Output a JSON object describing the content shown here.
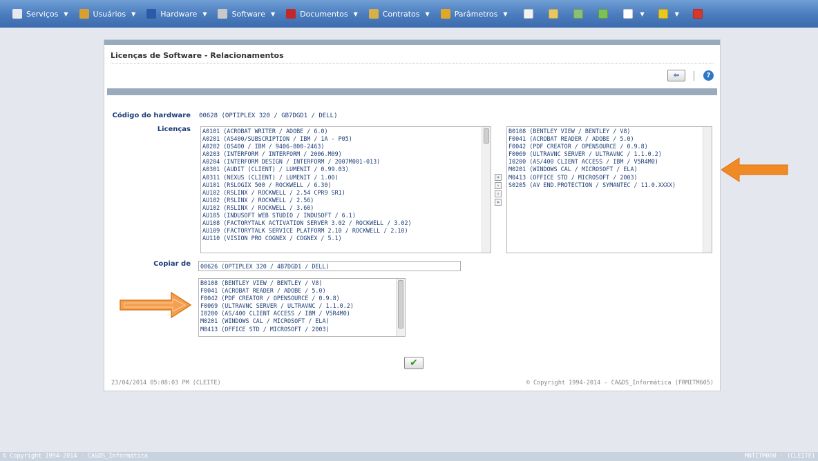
{
  "menubar": {
    "items": [
      {
        "label": "Serviços",
        "icon": "services-icon",
        "color": "#e8e8f0"
      },
      {
        "label": "Usuários",
        "icon": "users-icon",
        "color": "#d8a030"
      },
      {
        "label": "Hardware",
        "icon": "hardware-icon",
        "color": "#2a5aa8"
      },
      {
        "label": "Software",
        "icon": "software-icon",
        "color": "#c8c8c8"
      },
      {
        "label": "Documentos",
        "icon": "documents-icon",
        "color": "#c0282a"
      },
      {
        "label": "Contratos",
        "icon": "contracts-icon",
        "color": "#d8b048"
      },
      {
        "label": "Parâmetros",
        "icon": "parameters-icon",
        "color": "#e0a828"
      }
    ],
    "tools": [
      {
        "icon": "screen-icon",
        "color": "#f2f2f2"
      },
      {
        "icon": "notepad-icon",
        "color": "#e6c860"
      },
      {
        "icon": "globe-icon",
        "color": "#8ac070"
      },
      {
        "icon": "new-document-icon",
        "color": "#7cc05a"
      },
      {
        "icon": "search-icon",
        "color": "#ffffff",
        "caret": true
      },
      {
        "icon": "usb-icon",
        "color": "#e8c820",
        "caret": true
      },
      {
        "icon": "close-icon",
        "color": "#d8382a"
      }
    ]
  },
  "page": {
    "title": "Licenças de Software - Relacionamentos",
    "back_label": "⇦",
    "help_label": "?",
    "hardware_label": "Código do hardware",
    "hardware_value": "00628 (OPTIPLEX 320 / GB7DGD1 / DELL)",
    "licenses_label": "Licenças",
    "available_licenses": [
      "A0101 (ACROBAT WRITER / ADOBE / 6.0)",
      "A0201 (AS400/SUBSCRIPTION / IBM / 1A - P05)",
      "A0202 (OS400 / IBM / 9406-800-2463)",
      "A0203 (INTERFORM / INTERFORM / 2006.M09)",
      "A0204 (INTERFORM DESIGN / INTERFORM / 2007M001-013)",
      "A0301 (AUDIT (CLIENT) / LUMENIT / 0.99.03)",
      "A0311 (NEXUS (CLIENT) / LUMENIT / 1.00)",
      "AU101 (RSLOGIX 500 / ROCKWELL / 6.30)",
      "AU102 (RSLINX / ROCKWELL / 2.54 CPR9 SR1)",
      "AU102 (RSLINX / ROCKWELL / 2.56)",
      "AU102 (RSLINX / ROCKWELL / 3.60)",
      "AU105 (INDUSOFT WEB STUDIO / INDUSOFT / 6.1)",
      "AU108 (FACTORYTALK ACTIVATION SERVER 3.02 / ROCKWELL / 3.02)",
      "AU109 (FACTORYTALK SERVICE PLATFORM 2.10 / ROCKWELL / 2.10)",
      "AU110 (VISION PRO COGNEX / COGNEX / 5.1)"
    ],
    "selected_licenses": [
      "B0108 (BENTLEY VIEW / BENTLEY / V8)",
      "F0041 (ACROBAT READER / ADOBE / 5.0)",
      "F0042 (PDF CREATOR / OPENSOURCE / 0.9.8)",
      "F0069 (ULTRAVNC SERVER / ULTRAVNC / 1.1.0.2)",
      "I0200 (AS/400 CLIENT ACCESS / IBM / V5R4M0)",
      "M0201 (WINDOWS CAL / MICROSOFT / ELA)",
      "M0413 (OFFICE STD / MICROSOFT / 2003)",
      "S0205 (AV END.PROTECTION / SYMANTEC / 11.0.XXXX)"
    ],
    "move_buttons": {
      "add_all": "»",
      "add_one": "›",
      "remove_one": "‹",
      "remove_all": "«"
    },
    "copy_label": "Copiar de",
    "copy_value": "00626 (OPTIPLEX 320 / 4B7DGD1 / DELL)",
    "copy_licenses": [
      "B0108 (BENTLEY VIEW / BENTLEY / V8)",
      "F0041 (ACROBAT READER / ADOBE / 5.0)",
      "F0042 (PDF CREATOR / OPENSOURCE / 0.9.8)",
      "F0069 (ULTRAVNC SERVER / ULTRAVNC / 1.1.0.2)",
      "I0200 (AS/400 CLIENT ACCESS / IBM / V5R4M0)",
      "M0201 (WINDOWS CAL / MICROSOFT / ELA)",
      "M0413 (OFFICE STD / MICROSOFT / 2003)"
    ],
    "confirm_label": "✔",
    "timestamp": "23/04/2014  05:08:03 PM (CLEITE)",
    "copyright": "© Copyright 1994-2014 - CA&DS_Informática (FRMITM605)"
  },
  "footer": {
    "left": "© Copyright 1994-2014 - CA&DS_Informática",
    "right": "MNTITM000 - (CLEITE)"
  },
  "colors": {
    "accent_arrow": "#f08a24",
    "menubar": "#4a7bbd",
    "link_text": "#1c3d78"
  }
}
